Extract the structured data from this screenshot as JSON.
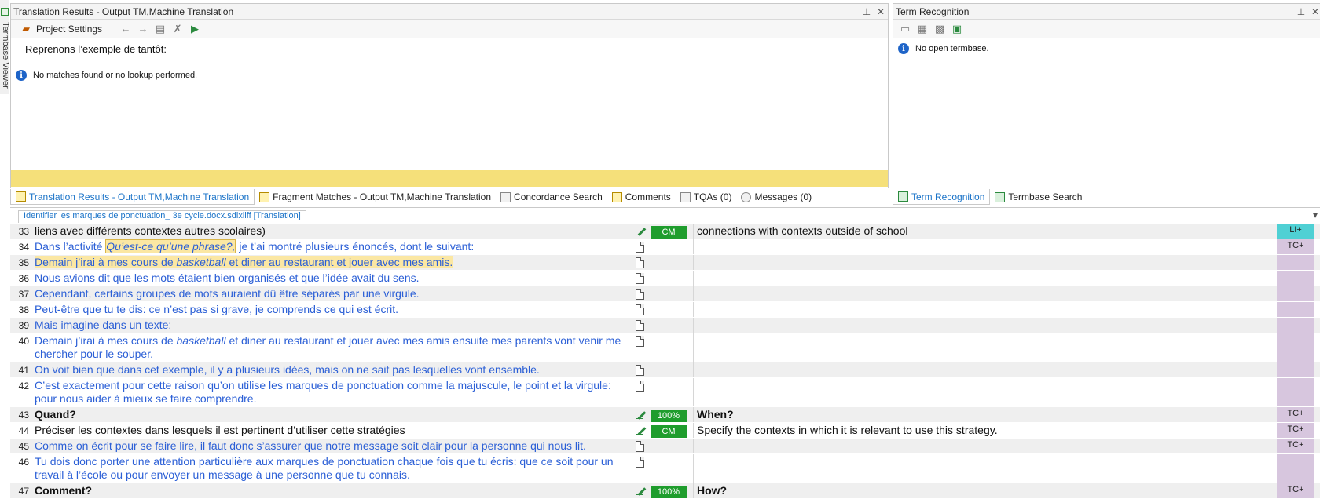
{
  "left_strip": {
    "label": "Termbase Viewer"
  },
  "translation_results": {
    "title": "Translation Results - Output TM,Machine Translation",
    "toolbar": {
      "project_settings": "Project Settings"
    },
    "source_text": "Reprenons l’exemple de tantôt:",
    "info": "No matches found or no lookup performed."
  },
  "term_recognition": {
    "title": "Term Recognition",
    "info": "No open termbase."
  },
  "tabs_left": [
    "Translation Results - Output TM,Machine Translation",
    "Fragment Matches - Output TM,Machine Translation",
    "Concordance Search",
    "Comments",
    "TQAs (0)",
    "Messages (0)"
  ],
  "tabs_right": [
    "Term Recognition",
    "Termbase Search"
  ],
  "editor": {
    "doc_tab": "Identifier les marques de ponctuation_ 3e cycle.docx.sdlxliff [Translation]",
    "rows": [
      {
        "num": "33",
        "parts": [
          {
            "t": "liens avec différents contextes autres scolaires)"
          }
        ],
        "status": "CM",
        "target": "connections with contexts outside of school",
        "tc": "LI+"
      },
      {
        "num": "34",
        "parts": [
          {
            "t": "Dans l’activité "
          },
          {
            "t": "Qu’est-ce qu’une phrase?,"
          },
          {
            "t": " je t’ai montré plusieurs énoncés, dont le suivant:"
          }
        ],
        "status": "",
        "target": "",
        "tc": "TC+"
      },
      {
        "num": "35",
        "parts": [
          {
            "t": "Demain j’irai à mes cours de "
          },
          {
            "t": "basketball"
          },
          {
            "t": " et diner au restaurant et jouer avec mes amis."
          }
        ],
        "status": "",
        "target": "",
        "tc": ""
      },
      {
        "num": "36",
        "parts": [
          {
            "t": "Nous avions dit que les mots étaient bien organisés et que l’idée avait du sens."
          }
        ],
        "status": "",
        "target": "",
        "tc": ""
      },
      {
        "num": "37",
        "parts": [
          {
            "t": "Cependant, certains groupes de mots auraient dû être séparés par une virgule."
          }
        ],
        "status": "",
        "target": "",
        "tc": ""
      },
      {
        "num": "38",
        "parts": [
          {
            "t": "Peut-être que tu te dis: ce n’est pas si grave, je comprends ce qui est écrit."
          }
        ],
        "status": "",
        "target": "",
        "tc": ""
      },
      {
        "num": "39",
        "parts": [
          {
            "t": "Mais imagine dans un texte:"
          }
        ],
        "status": "",
        "target": "",
        "tc": ""
      },
      {
        "num": "40",
        "parts": [
          {
            "t": "Demain j’irai à mes cours de "
          },
          {
            "t": "basketball"
          },
          {
            "t": " et diner au restaurant et jouer avec mes amis ensuite mes parents vont venir me chercher pour le souper."
          }
        ],
        "status": "",
        "target": "",
        "tc": ""
      },
      {
        "num": "41",
        "parts": [
          {
            "t": "On voit bien que dans cet exemple, il y a plusieurs idées, mais on ne sait pas lesquelles vont ensemble."
          }
        ],
        "status": "",
        "target": "",
        "tc": ""
      },
      {
        "num": "42",
        "parts": [
          {
            "t": "C’est exactement pour cette raison qu’on utilise les marques de ponctuation comme la majuscule, le point et la virgule: pour nous aider à mieux se faire comprendre."
          }
        ],
        "status": "",
        "target": "",
        "tc": ""
      },
      {
        "num": "43",
        "parts": [
          {
            "t": "Quand?"
          }
        ],
        "status": "100%",
        "target": "When?",
        "tc": "TC+"
      },
      {
        "num": "44",
        "parts": [
          {
            "t": "Préciser les contextes dans lesquels il est pertinent d’utiliser cette stratégies"
          }
        ],
        "status": "CM",
        "target": "Specify the contexts in which it is relevant to use this strategy.",
        "tc": "TC+"
      },
      {
        "num": "45",
        "parts": [
          {
            "t": "Comme on écrit pour se faire lire, il faut donc s’assurer que notre message soit clair pour la personne qui nous lit."
          }
        ],
        "status": "",
        "target": "",
        "tc": "TC+"
      },
      {
        "num": "46",
        "parts": [
          {
            "t": "Tu dois donc porter une attention particulière aux marques de ponctuation chaque fois que tu écris: que ce soit pour un travail à l’école ou pour envoyer un message à une personne que tu connais."
          }
        ],
        "status": "",
        "target": "",
        "tc": ""
      },
      {
        "num": "47",
        "parts": [
          {
            "t": "Comment?"
          }
        ],
        "status": "100%",
        "target": "How?",
        "tc": "TC+"
      }
    ]
  }
}
